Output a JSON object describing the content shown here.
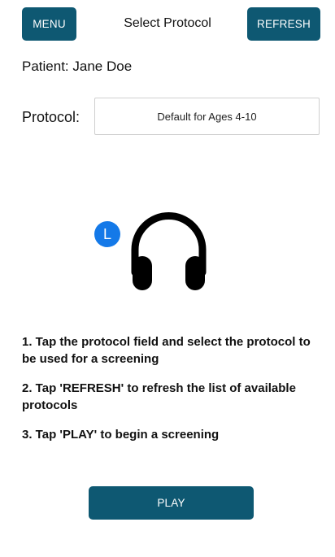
{
  "header": {
    "menu_label": "MENU",
    "title": "Select Protocol",
    "refresh_label": "REFRESH"
  },
  "patient": {
    "text": "Patient: Jane Doe"
  },
  "protocol": {
    "label": "Protocol:",
    "selected_value": "Default for Ages 4-10"
  },
  "headphone": {
    "side_badge": "L",
    "icon": "headphones-icon",
    "badge_color": "#1479e8"
  },
  "instructions": [
    "1. Tap the protocol field and select the protocol to be used for a screening",
    "2. Tap 'REFRESH' to refresh the list of available protocols",
    "3. Tap 'PLAY' to begin a screening"
  ],
  "footer": {
    "play_label": "PLAY"
  },
  "colors": {
    "button_bg": "#0e5872",
    "button_text": "#ffffff"
  }
}
